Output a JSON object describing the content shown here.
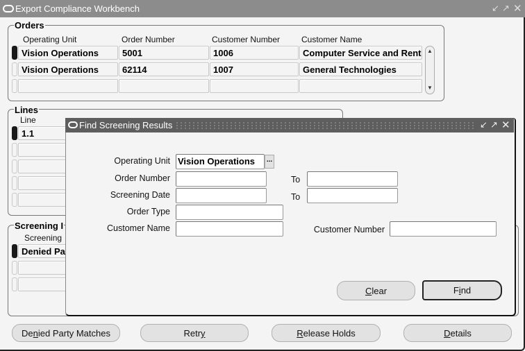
{
  "window": {
    "title": "Export Compliance Workbench",
    "controls": [
      "minimize-icon",
      "maximize-icon",
      "close-icon"
    ]
  },
  "orders": {
    "label": "Orders",
    "columns": [
      "Operating Unit",
      "Order Number",
      "Customer Number",
      "Customer Name"
    ],
    "rows": [
      {
        "operating_unit": "Vision Operations",
        "order_number": "5001",
        "customer_number": "1006",
        "customer_name": "Computer Service and Rentals",
        "current": true
      },
      {
        "operating_unit": "Vision Operations",
        "order_number": "62114",
        "customer_number": "1007",
        "customer_name": "General Technologies",
        "current": false
      },
      {
        "operating_unit": "",
        "order_number": "",
        "customer_number": "",
        "customer_name": "",
        "current": false
      }
    ]
  },
  "lines": {
    "label": "Lines",
    "columns": [
      "Line"
    ],
    "rows": [
      {
        "line": "1.1",
        "current": true
      },
      {
        "line": ""
      },
      {
        "line": ""
      },
      {
        "line": ""
      },
      {
        "line": ""
      }
    ]
  },
  "screening": {
    "label": "Screening I",
    "columns": [
      "Screening"
    ],
    "rows": [
      {
        "value": "Denied Pa",
        "current": true
      },
      {
        "value": ""
      },
      {
        "value": ""
      }
    ]
  },
  "buttons": {
    "denied_party_matches": {
      "pre": "De",
      "mn": "n",
      "post": "ied Party Matches"
    },
    "retry": {
      "pre": "Retr",
      "mn": "y",
      "post": ""
    },
    "release_holds": {
      "pre": "",
      "mn": "R",
      "post": "elease Holds"
    },
    "details": {
      "pre": "",
      "mn": "D",
      "post": "etails"
    }
  },
  "dialog": {
    "title": "Find Screening Results",
    "fields": {
      "operating_unit": {
        "label": "Operating Unit",
        "value": "Vision Operations"
      },
      "order_number": {
        "label": "Order Number",
        "value": "",
        "to_label": "To",
        "to_value": ""
      },
      "screening_date": {
        "label": "Screening Date",
        "value": "",
        "to_label": "To",
        "to_value": ""
      },
      "order_type": {
        "label": "Order Type",
        "value": ""
      },
      "customer_name": {
        "label": "Customer Name",
        "value": ""
      },
      "customer_number": {
        "label": "Customer Number",
        "value": ""
      }
    },
    "lov_label": "...",
    "clear": {
      "pre": "",
      "mn": "C",
      "post": "lear"
    },
    "find": {
      "pre": "F",
      "mn": "i",
      "post": "nd"
    }
  }
}
